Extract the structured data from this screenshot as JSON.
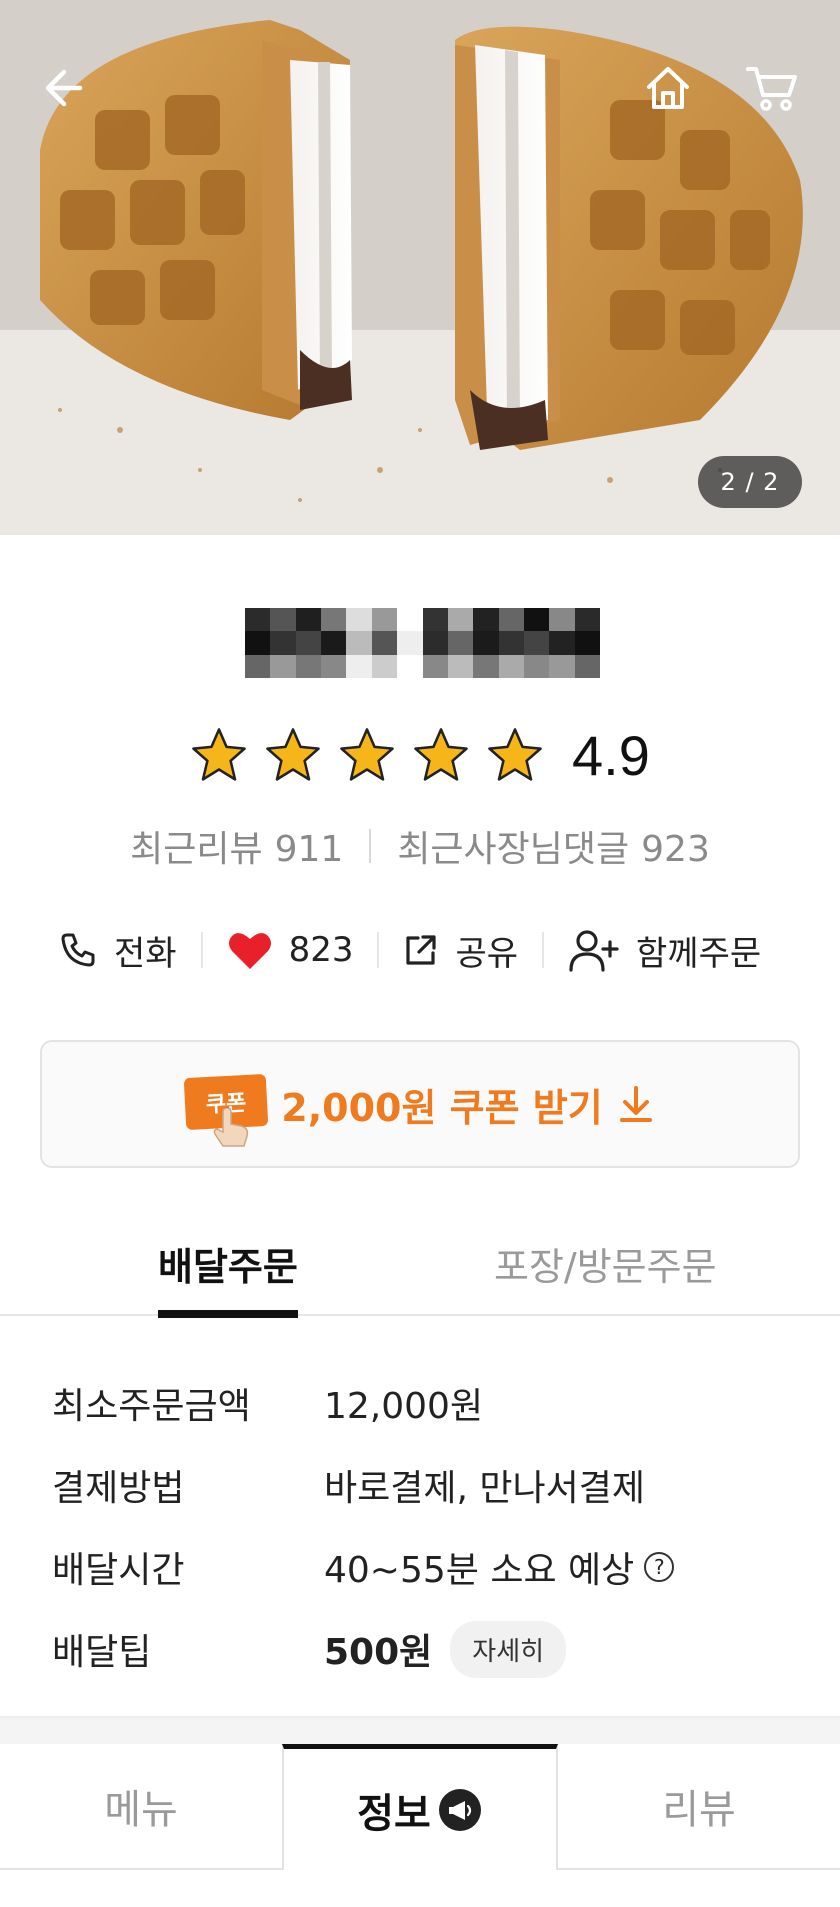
{
  "header": {
    "back_icon": "arrow-left-icon",
    "home_icon": "home-icon",
    "cart_icon": "cart-icon",
    "page_indicator": "2 / 2"
  },
  "store": {
    "name": "",
    "name_note": "pixelated/mosaic",
    "rating": "4.9",
    "stars": 5,
    "recent_reviews_label": "최근리뷰",
    "recent_reviews_count": "911",
    "owner_replies_label": "최근사장님댓글",
    "owner_replies_count": "923"
  },
  "actions": {
    "call_label": "전화",
    "like_count": "823",
    "share_label": "공유",
    "group_order_label": "함께주문"
  },
  "coupon": {
    "badge": "쿠폰",
    "label": "2,000원 쿠폰 받기"
  },
  "order_tabs": {
    "delivery": "배달주문",
    "pickup": "포장/방문주문"
  },
  "info": {
    "min_order_label": "최소주문금액",
    "min_order_value": "12,000원",
    "payment_label": "결제방법",
    "payment_value": "바로결제, 만나서결제",
    "delivery_time_label": "배달시간",
    "delivery_time_value": "40~55분 소요 예상",
    "delivery_tip_label": "배달팁",
    "delivery_tip_value": "500원",
    "detail_label": "자세히"
  },
  "bottom_tabs": {
    "menu": "메뉴",
    "info": "정보",
    "review": "리뷰"
  },
  "colors": {
    "accent": "#f07a1e",
    "heart": "#e8202a",
    "star": "#f6b619"
  }
}
